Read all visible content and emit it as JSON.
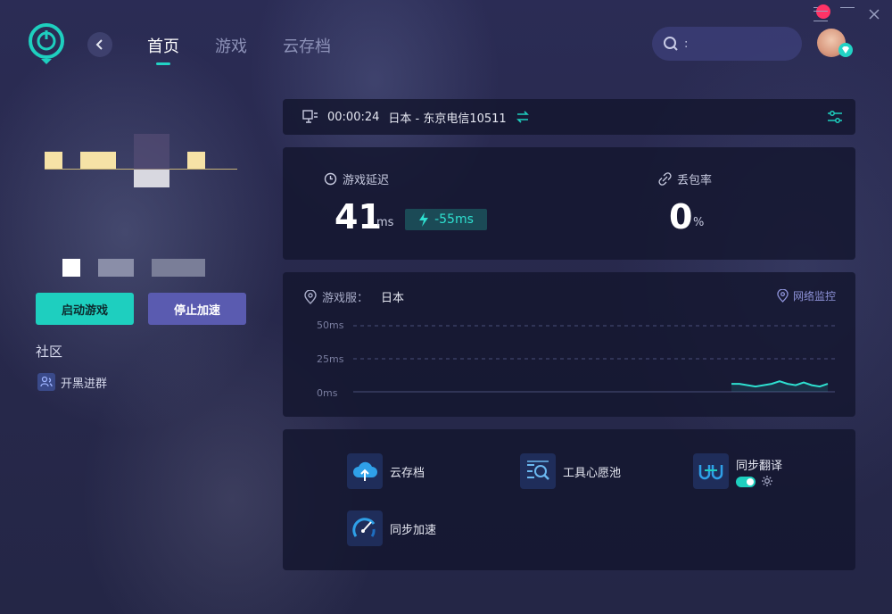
{
  "nav": {
    "tabs": [
      {
        "label": "首页",
        "active": true
      },
      {
        "label": "游戏",
        "active": false
      },
      {
        "label": "云存档",
        "active": false
      }
    ]
  },
  "search": {
    "placeholder": ":"
  },
  "actions": {
    "start_label": "启动游戏",
    "stop_label": "停止加速"
  },
  "community": {
    "title": "社区",
    "group_label": "开黑进群"
  },
  "connection": {
    "timer": "00:00:24",
    "route": "日本 - 东京电信10511"
  },
  "stats": {
    "latency_label": "游戏延迟",
    "latency_value": "41",
    "latency_unit": "ms",
    "latency_delta": "-55ms",
    "loss_label": "丢包率",
    "loss_value": "0",
    "loss_unit": "%"
  },
  "graph": {
    "server_label": "游戏服：",
    "server_value": "日本",
    "monitor_label": "网络监控",
    "y_ticks": [
      "50ms",
      "25ms",
      "0ms"
    ]
  },
  "chart_data": {
    "type": "area",
    "ylim": [
      0,
      50
    ],
    "y_ticks": [
      50,
      25,
      0
    ],
    "values": [
      6,
      6,
      5,
      4,
      5,
      6,
      8,
      6,
      5,
      7,
      5,
      4,
      6
    ]
  },
  "tools": [
    {
      "label": "云存档",
      "icon": "cloud-upload-icon"
    },
    {
      "label": "工具心愿池",
      "icon": "wish-pool-icon"
    },
    {
      "label": "同步翻译",
      "icon": "translate-icon",
      "toggle_on": true
    },
    {
      "label": "同步加速",
      "icon": "speedometer-icon"
    }
  ],
  "colors": {
    "accent": "#1ecfbf",
    "secondary": "#5a5bb0",
    "background": "#28294d"
  }
}
